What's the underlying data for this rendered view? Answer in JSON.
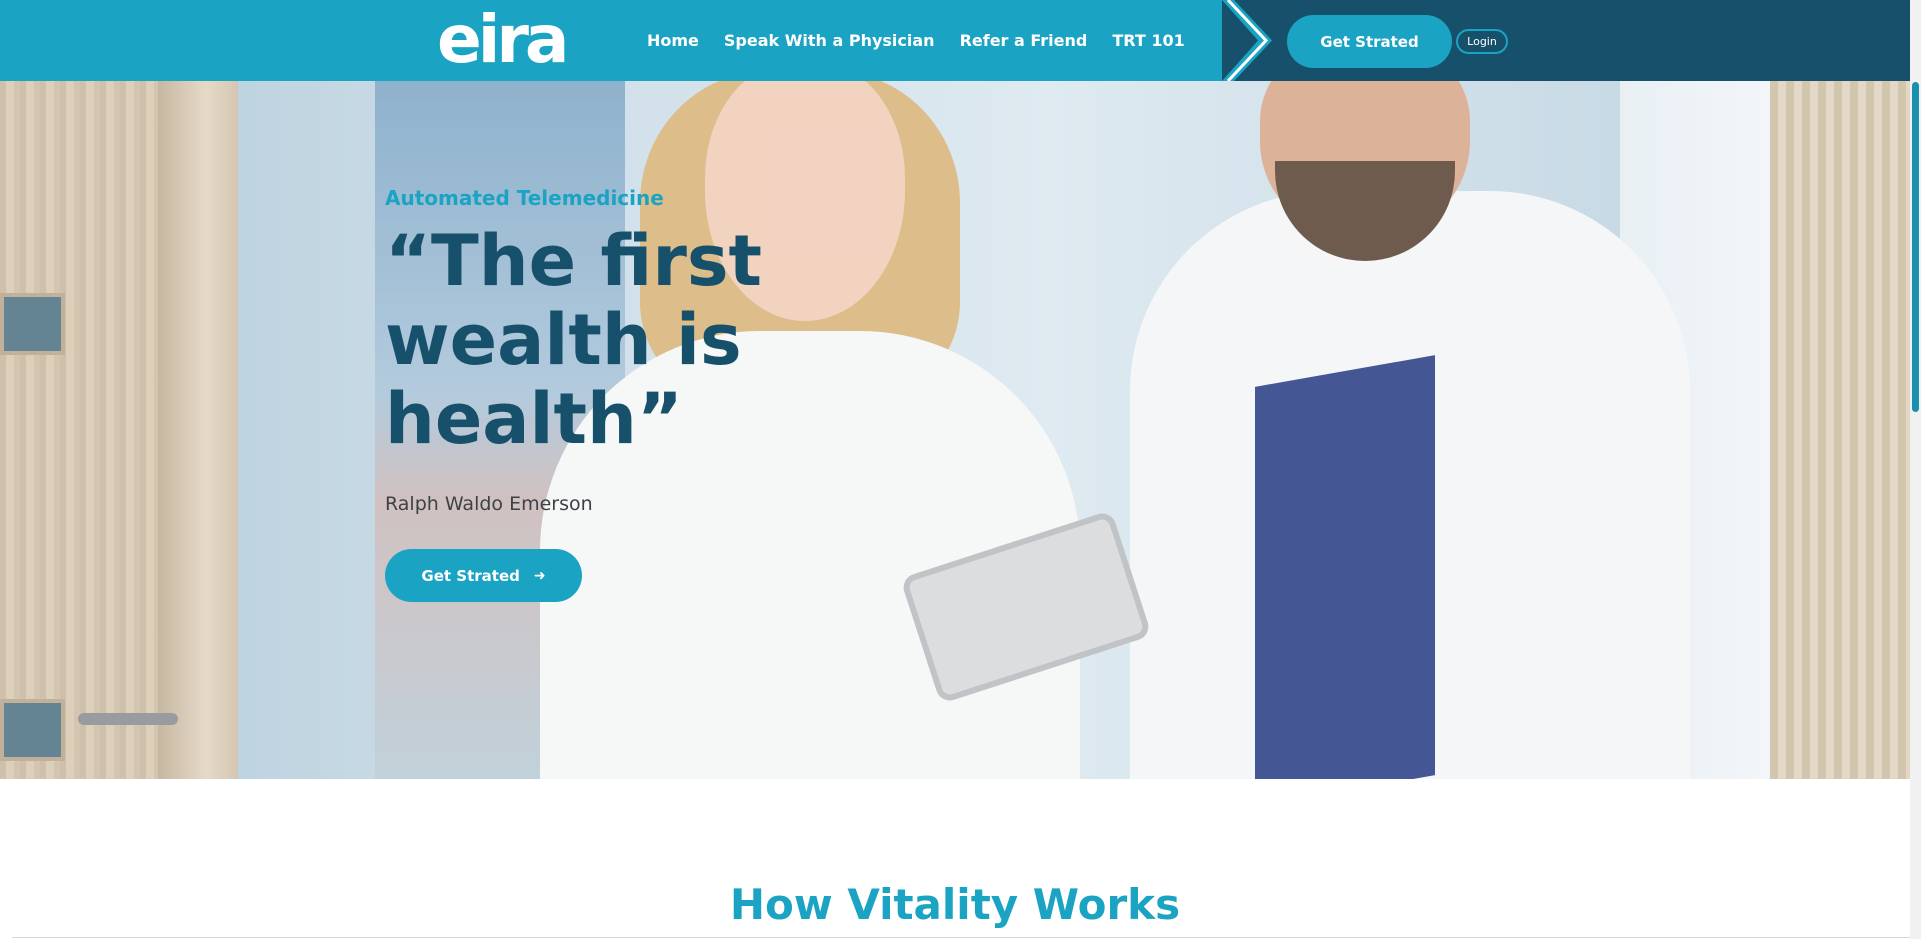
{
  "brand": {
    "logo_text": "eira"
  },
  "nav": {
    "links": [
      {
        "label": "Home"
      },
      {
        "label": "Speak With a Physician"
      },
      {
        "label": "Refer a Friend"
      },
      {
        "label": "TRT 101"
      }
    ],
    "cta_label": "Get Strated",
    "login_label": "Login"
  },
  "hero": {
    "eyebrow": "Automated Telemedicine",
    "headline": "“The first wealth is health”",
    "author": "Ralph Waldo Emerson",
    "cta_label": "Get Strated",
    "cta_icon": "arrow-right-icon"
  },
  "section": {
    "title": "How Vitality Works"
  },
  "colors": {
    "primary": "#1ba3c4",
    "dark": "#17506b",
    "text": "#3c4247"
  }
}
